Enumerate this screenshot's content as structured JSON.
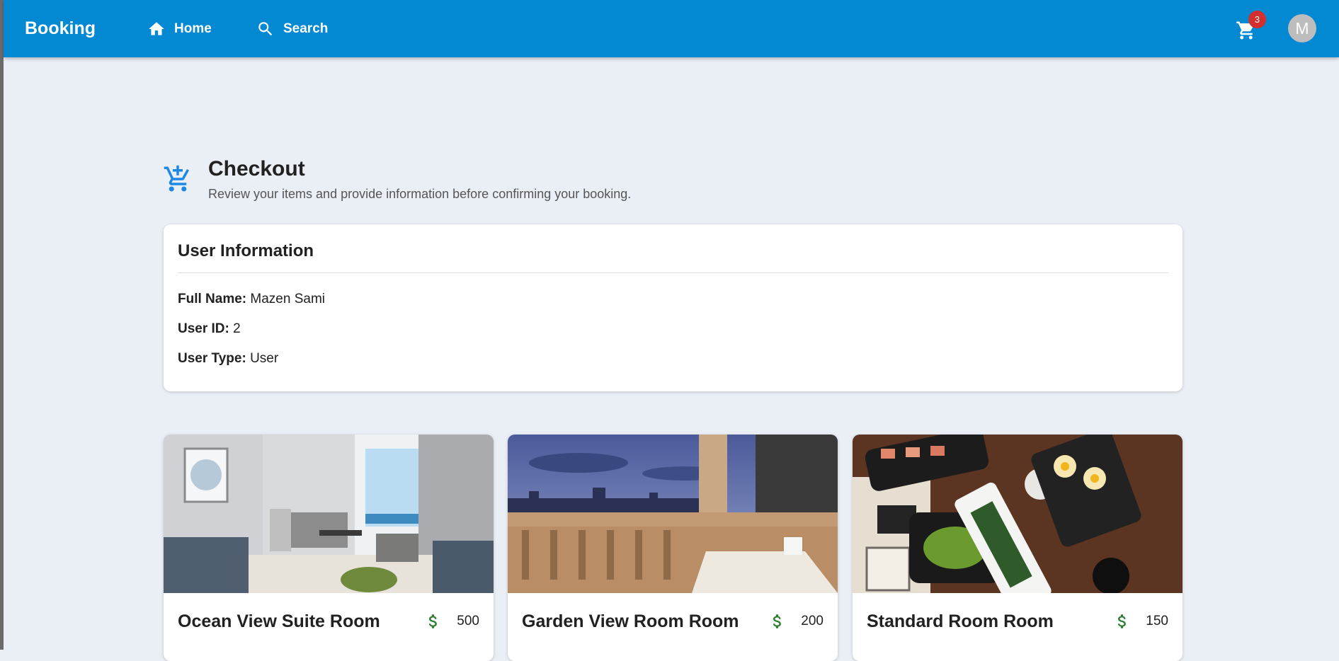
{
  "appbar": {
    "brand": "Booking",
    "nav": [
      {
        "label": "Home",
        "icon": "home-icon"
      },
      {
        "label": "Search",
        "icon": "search-icon"
      }
    ],
    "cart_count": "3",
    "avatar_initial": "M",
    "color": "#0388d2"
  },
  "checkout": {
    "title": "Checkout",
    "subtitle": "Review your items and provide information before confirming your booking.",
    "icon": "cart-arrow-icon"
  },
  "user_info": {
    "heading": "User Information",
    "fields": [
      {
        "label": "Full Name:",
        "value": "Mazen Sami"
      },
      {
        "label": "User ID:",
        "value": "2"
      },
      {
        "label": "User Type:",
        "value": "User"
      }
    ]
  },
  "rooms": [
    {
      "name": "Ocean View Suite Room",
      "price": "500",
      "image": "ocean-view-suite-photo"
    },
    {
      "name": "Garden View Room Room",
      "price": "200",
      "image": "garden-view-balcony-photo"
    },
    {
      "name": "Standard Room Room",
      "price": "150",
      "image": "standard-room-food-photo"
    }
  ],
  "colors": {
    "background": "#eaeef5",
    "accent": "#1e88e5",
    "price": "#2e7d32",
    "badge": "#d32f2f"
  }
}
